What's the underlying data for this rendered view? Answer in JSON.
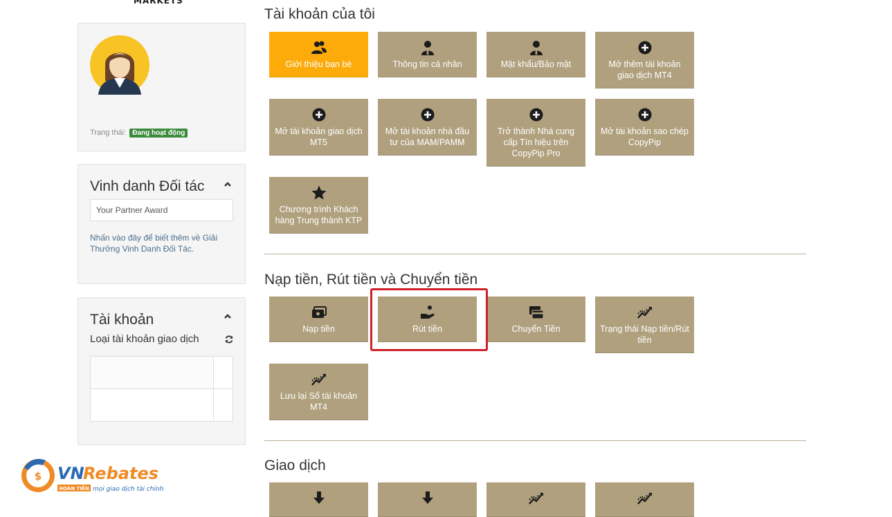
{
  "brand": {
    "top_text": "MARKETS"
  },
  "profile": {
    "status_label": "Trạng thái:",
    "status_value": "Đang hoạt động"
  },
  "partner": {
    "title": "Vinh danh Đối tác",
    "input_placeholder": "Your Partner Award",
    "note": "Nhấn vào đây để biết thêm về Giải Thưởng Vinh Danh Đối Tác."
  },
  "account": {
    "title": "Tài khoản",
    "subtitle": "Loại tài khoản giao dịch"
  },
  "sections": {
    "my_account": {
      "title": "Tài khoản của tôi",
      "tiles": [
        {
          "label": "Giới thiệu bạn bè",
          "icon": "users-icon",
          "active": true
        },
        {
          "label": "Thông tin cá nhân",
          "icon": "user-icon"
        },
        {
          "label": "Mật khẩu/Bảo mật",
          "icon": "user-icon"
        },
        {
          "label": "Mở thêm tài khoản giao dịch MT4",
          "icon": "plus-circle-icon"
        },
        {
          "label": "Mở tài khoản giao dịch MT5",
          "icon": "plus-circle-icon"
        },
        {
          "label": "Mở tài khoản nhà đầu tư của MAM/PAMM",
          "icon": "plus-circle-icon"
        },
        {
          "label": "Trở thành Nhà cung cấp Tín hiệu trên CopyPip Pro",
          "icon": "plus-circle-icon"
        },
        {
          "label": "Mở tài khoản sao chép CopyPip",
          "icon": "plus-circle-icon"
        },
        {
          "label": "Chương trình Khách hàng Trung thành KTP",
          "icon": "star-icon"
        }
      ]
    },
    "funds": {
      "title": "Nạp tiền, Rút tiền và Chuyển tiền",
      "tiles": [
        {
          "label": "Nạp tiền",
          "icon": "deposit-icon"
        },
        {
          "label": "Rút tiền",
          "icon": "withdraw-icon"
        },
        {
          "label": "Chuyển Tiền",
          "icon": "transfer-icon"
        },
        {
          "label": "Trạng thái Nạp tiền/Rút tiền",
          "icon": "chart-line-icon"
        },
        {
          "label": "Lưu lại Sổ tài khoản MT4",
          "icon": "chart-line-icon"
        }
      ]
    },
    "trading": {
      "title": "Giao dịch",
      "tiles": [
        {
          "icon": "download-icon"
        },
        {
          "icon": "download-icon"
        },
        {
          "icon": "chart-line-icon"
        },
        {
          "icon": "chart-line-icon"
        }
      ]
    }
  },
  "watermark": {
    "name": "VNRebates",
    "tag": "HOÀN TIỀN",
    "slogan": "mọi giao dịch tài chính"
  },
  "colors": {
    "tile": "#b0a07e",
    "tile_active": "#fcab0b",
    "highlight": "#d01f26",
    "badge": "#3a8a3a"
  }
}
